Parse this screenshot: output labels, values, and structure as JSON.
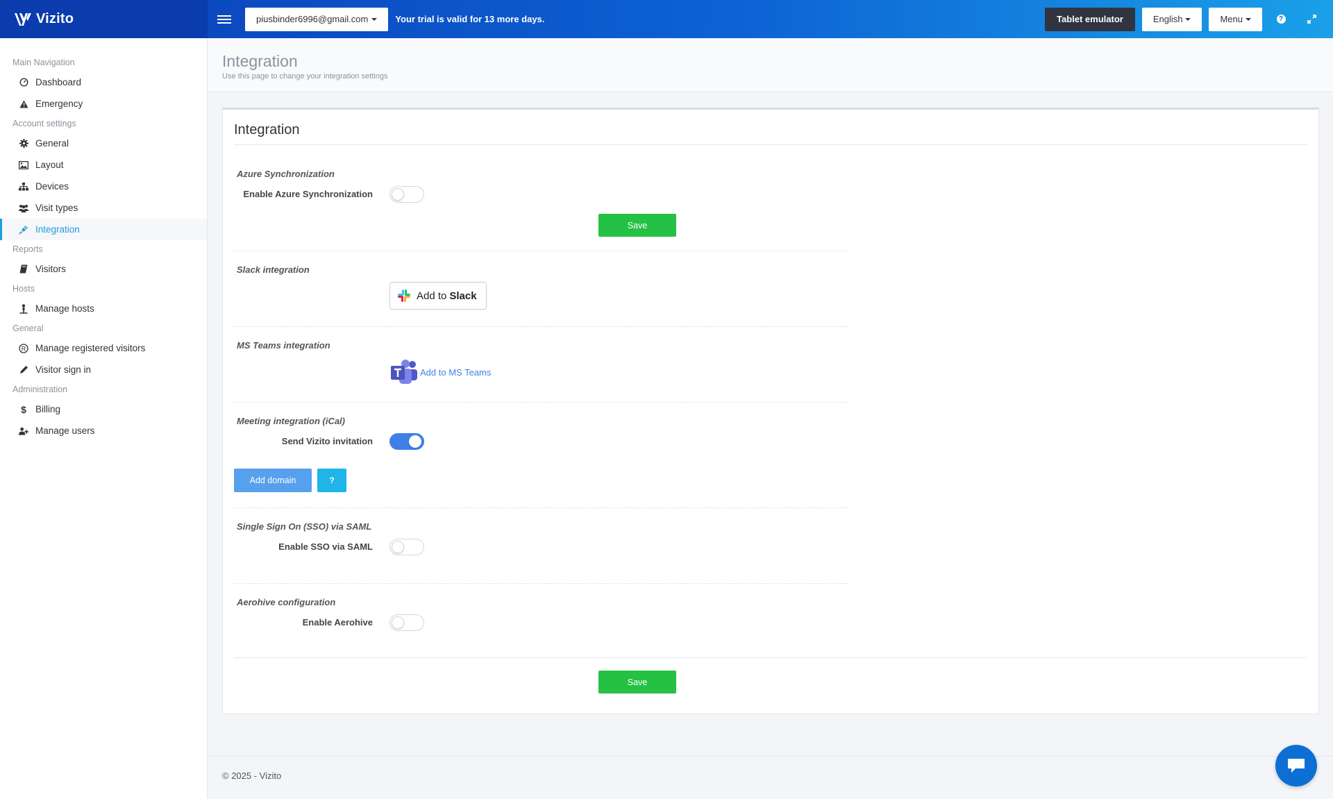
{
  "brand": {
    "name": "Vizito"
  },
  "topbar": {
    "account": "piusbinder6996@gmail.com",
    "trial_text": "Your trial is valid for 13 more days.",
    "tablet_emulator": "Tablet emulator",
    "language": "English",
    "menu": "Menu",
    "help_icon": "?"
  },
  "sidebar": {
    "sections": [
      {
        "header": "Main Navigation",
        "items": [
          {
            "label": "Dashboard",
            "icon": "gauge-icon"
          },
          {
            "label": "Emergency",
            "icon": "warning-icon"
          }
        ]
      },
      {
        "header": "Account settings",
        "items": [
          {
            "label": "General",
            "icon": "gear-icon"
          },
          {
            "label": "Layout",
            "icon": "image-icon"
          },
          {
            "label": "Devices",
            "icon": "sitemap-icon"
          },
          {
            "label": "Visit types",
            "icon": "users-icon"
          },
          {
            "label": "Integration",
            "icon": "plug-icon",
            "active": true
          }
        ]
      },
      {
        "header": "Reports",
        "items": [
          {
            "label": "Visitors",
            "icon": "book-icon"
          }
        ]
      },
      {
        "header": "Hosts",
        "items": [
          {
            "label": "Manage hosts",
            "icon": "person-icon"
          }
        ]
      },
      {
        "header": "General",
        "items": [
          {
            "label": "Manage registered visitors",
            "icon": "registered-icon"
          },
          {
            "label": "Visitor sign in",
            "icon": "pencil-icon"
          }
        ]
      },
      {
        "header": "Administration",
        "items": [
          {
            "label": "Billing",
            "icon": "dollar-icon"
          },
          {
            "label": "Manage users",
            "icon": "user-plus-icon"
          }
        ]
      }
    ]
  },
  "page": {
    "title": "Integration",
    "subtitle": "Use this page to change your integration settings"
  },
  "card": {
    "title": "Integration",
    "azure": {
      "title": "Azure Synchronization",
      "label": "Enable Azure Synchronization",
      "enabled": false,
      "save": "Save"
    },
    "slack": {
      "title": "Slack integration",
      "button_prefix": "Add to",
      "button_brand": "Slack"
    },
    "teams": {
      "title": "MS Teams integration",
      "link": "Add to MS Teams"
    },
    "meeting": {
      "title": "Meeting integration (iCal)",
      "label": "Send Vizito invitation",
      "enabled": true,
      "add_domain": "Add domain",
      "help": "?"
    },
    "sso": {
      "title": "Single Sign On (SSO) via SAML",
      "label": "Enable SSO via SAML",
      "enabled": false
    },
    "aerohive": {
      "title": "Aerohive configuration",
      "label": "Enable Aerohive",
      "enabled": false
    },
    "save": "Save"
  },
  "footer": {
    "text": "© 2025 - Vizito"
  },
  "colors": {
    "topbar_start": "#0a40b5",
    "topbar_end": "#1aa0e8",
    "accent": "#1e9dd9",
    "save_green": "#25c144",
    "toggle_on": "#3f80e8"
  }
}
